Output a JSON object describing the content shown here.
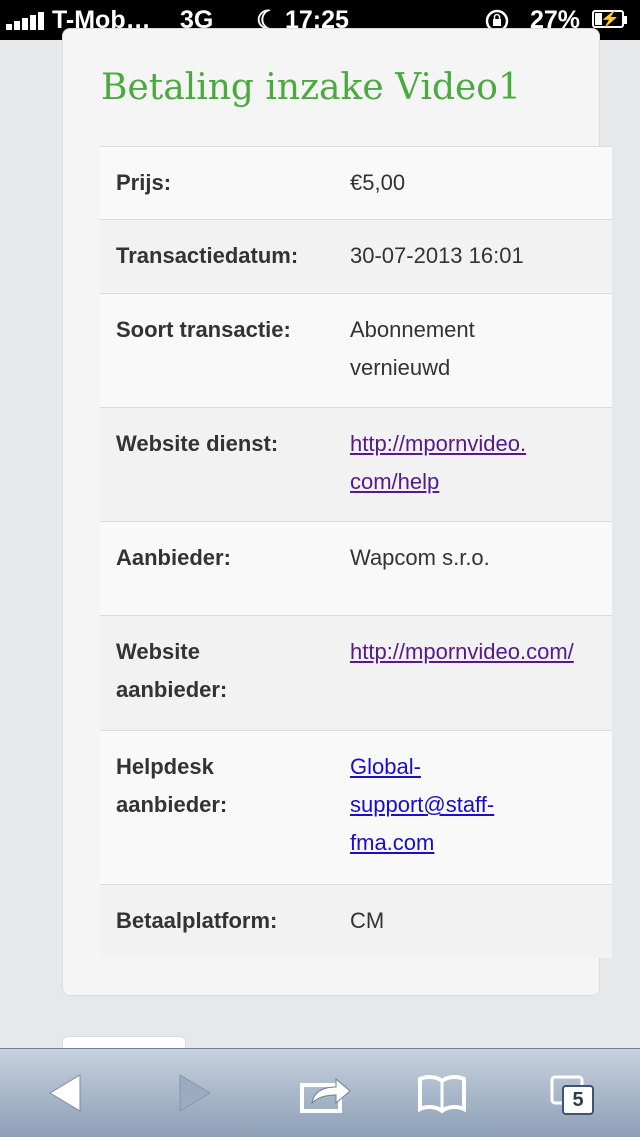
{
  "status_bar": {
    "carrier": "T-Mob…",
    "network": "3G",
    "time": "17:25",
    "battery": "27%",
    "battery_level": 0.27,
    "signal_bars": 5
  },
  "page": {
    "title": "Betaling inzake Video1",
    "rows": [
      {
        "label": "Prijs:",
        "value": "€5,00"
      },
      {
        "label": "Transactiedatum:",
        "value": "30-07-2013 16:01"
      },
      {
        "label": "Soort transactie:",
        "value": "Abonnement vernieuwd"
      },
      {
        "label": "Website dienst:",
        "value": "http://mpornvideo.com/help"
      },
      {
        "label": "Aanbieder:",
        "value": "Wapcom s.r.o."
      },
      {
        "label": "Website aanbieder:",
        "value": "http://mpornvideo.com/"
      },
      {
        "label": "Helpdesk aanbieder:",
        "value": "Global-support@staff-fma.com"
      },
      {
        "label": "Betaalplatform:",
        "value": "CM"
      }
    ]
  },
  "toolbar": {
    "back_icon": "back-arrow-icon",
    "forward_icon": "forward-arrow-icon",
    "share_icon": "share-icon",
    "bookmarks_icon": "bookmarks-book-icon",
    "tabs_icon": "tabs-icon",
    "tab_count": "5"
  },
  "colors": {
    "title": "#4aaa3e",
    "visited_link": "#551a8b",
    "link": "#1a0dcc"
  }
}
